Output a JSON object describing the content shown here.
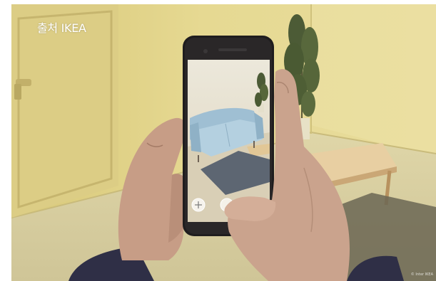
{
  "photo": {
    "caption": "출처 IKEA",
    "watermark": "© Inter IKEA"
  },
  "colors": {
    "wall": "#e3d58d",
    "wall_shadow": "#cbbd74",
    "floor": "#ddd4a6",
    "rug": "#6a6553",
    "table": "#e2c89a",
    "sofa": "#a8c6d8",
    "screen_bg": "#e9e4d8",
    "phone": "#1f1d1e",
    "hand": "#caa38d",
    "sleeve": "#2f2f46"
  },
  "icons": [
    "door",
    "potted-plant",
    "coffee-table",
    "smartphone",
    "sofa",
    "rug",
    "hand",
    "sleeve",
    "ar-button-icon"
  ]
}
